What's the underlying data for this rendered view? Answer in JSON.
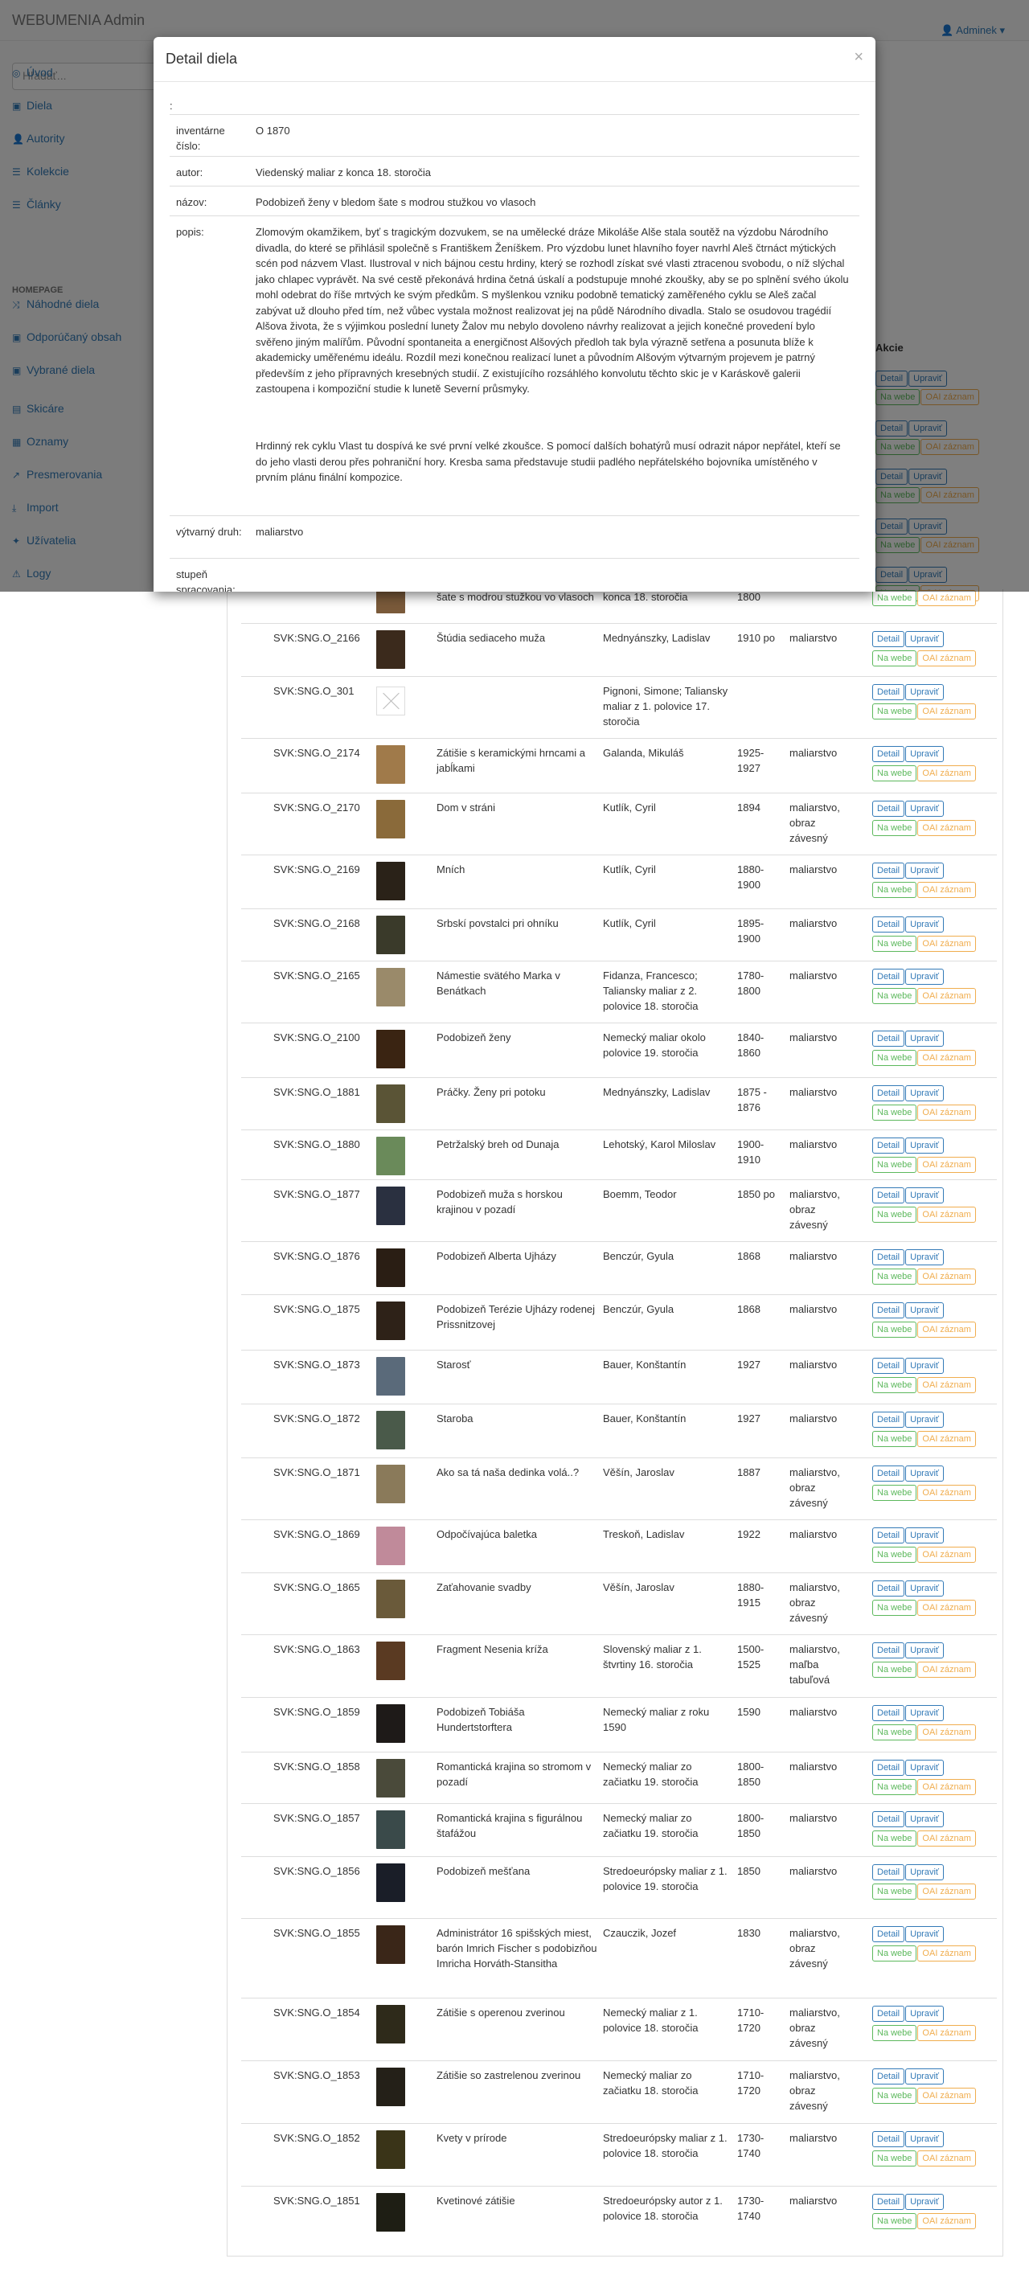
{
  "app": {
    "brand": "WEBUMENIA Admin",
    "user": "Adminek ▾"
  },
  "sidebar": {
    "search_placeholder": "Hľadať...",
    "items": [
      {
        "label": "Úvod",
        "icon": "dashboard-icon",
        "glyph": "◎"
      },
      {
        "label": "Diela",
        "icon": "image-icon",
        "glyph": "▣"
      },
      {
        "label": "Autority",
        "icon": "user-icon",
        "glyph": "👤"
      },
      {
        "label": "Kolekcie",
        "icon": "list-icon",
        "glyph": "☰"
      },
      {
        "label": "Články",
        "icon": "list-icon",
        "glyph": "☰"
      }
    ],
    "section": "HOMEPAGE",
    "items2": [
      {
        "label": "Náhodné diela",
        "icon": "random-icon",
        "glyph": "⤨"
      },
      {
        "label": "Odporúčaný obsah",
        "icon": "image-icon",
        "glyph": "▣"
      },
      {
        "label": "Vybrané diela",
        "icon": "image-icon",
        "glyph": "▣"
      }
    ],
    "items3": [
      {
        "label": "Skicáre",
        "icon": "book-icon",
        "glyph": "▤"
      },
      {
        "label": "Oznamy",
        "icon": "bullhorn-icon",
        "glyph": "▦"
      },
      {
        "label": "Presmerovania",
        "icon": "external-link-icon",
        "glyph": "↗"
      },
      {
        "label": "Import",
        "icon": "download-icon",
        "glyph": "⤓"
      },
      {
        "label": "Užívatelia",
        "icon": "male-icon",
        "glyph": "✦"
      },
      {
        "label": "Logy",
        "icon": "warning-icon",
        "glyph": "⚠"
      }
    ]
  },
  "modal": {
    "title": "Detail diela",
    "close": "×",
    "colon": ":",
    "rows": [
      {
        "label": "inventárne číslo:",
        "value": "O 1870"
      },
      {
        "label": "autor:",
        "value": "Viedenský maliar z konca 18. storočia"
      },
      {
        "label": "názov:",
        "value": "Podobizeň ženy v bledom šate s modrou stužkou vo vlasoch"
      },
      {
        "label": "popis:",
        "value": "Zlomovým okamžikem, byť s tragickým dozvukem, se na umělecké dráze Mikoláše Alše stala soutěž na výzdobu Národního divadla, do které se přihlásil společně s Františkem Ženíškem. Pro výzdobu lunet hlavního foyer navrhl Aleš čtrnáct mýtických scén pod názvem Vlast. Ilustroval v nich bájnou cestu hrdiny, který se rozhodl získat své vlasti ztracenou svobodu, o níž slýchal jako chlapec vyprávět. Na své cestě překonává hrdina četná úskalí a podstupuje mnohé zkoušky, aby se po splnění svého úkolu mohl odebrat do říše mrtvých ke svým předkům. S myšlenkou vzniku podobně tematický zaměřeného cyklu se Aleš začal zabývat už dlouho před tím, než vůbec vystala možnost realizovat jej na půdě Národního divadla. Stalo se osudovou tragédií Alšova života, že s výjimkou poslední lunety Žalov mu nebylo dovoleno návrhy realizovat a jejich konečné provedení bylo svěřeno jiným malířům. Původní spontaneita a energičnost Alšových předloh tak byla výrazně setřena a posunuta blíže k akademicky uměřenému ideálu. Rozdíl mezi konečnou realizací lunet a původním Alšovým výtvarným projevem je patrný především z jeho přípravných kresebných studií. Z existujícího rozsáhlého konvolutu těchto skic je v Karáskově galerii zastoupena i kompoziční studie k lunetě Severní průsmyky.",
        "value2": "Hrdinný rek cyklu Vlast tu dospívá ke své první velké zkoušce. S pomocí dalších bohatýrů musí odrazit nápor nepřátel, kteří se do jeho vlasti derou přes pohraniční hory. Kresba sama představuje studii padlého nepřátelského bojovníka umístěného v prvním plánu finální kompozice."
      },
      {
        "label": "výtvarný druh:",
        "value": "maliarstvo"
      },
      {
        "label": "stupeň spracovania:",
        "value": ""
      }
    ]
  },
  "behind": {
    "actions_header": "Akcie"
  },
  "buttons": {
    "detail": "Detail",
    "edit": "Upraviť",
    "web": "Na webe",
    "oai": "OAI záznam"
  },
  "first_row": {
    "name": "šate s modrou stužkou vo vlasoch",
    "author": "konca 18. storočia",
    "date": "1800",
    "type": "maliarstvo"
  },
  "rows": [
    {
      "id": "SVK:SNG.O_2166",
      "name": "Štúdia sediaceho muža",
      "author": "Mednyánszky, Ladislav",
      "date": "1910 po",
      "type": "maliarstvo",
      "color": "#3b2a1c"
    },
    {
      "id": "SVK:SNG.O_301",
      "name": "",
      "author": "Pignoni, Simone; Taliansky maliar z 1. polovice 17. storočia",
      "date": "",
      "type": "",
      "color": ""
    },
    {
      "id": "SVK:SNG.O_2174",
      "name": "Zátišie s keramickými hrncami a jabĺkami",
      "author": "Galanda, Mikuláš",
      "date": "1925-1927",
      "type": "maliarstvo",
      "color": "#a07a4a"
    },
    {
      "id": "SVK:SNG.O_2170",
      "name": "Dom v stráni",
      "author": "Kutlík, Cyril",
      "date": "1894",
      "type": "maliarstvo, obraz závesný",
      "color": "#8a6a3a"
    },
    {
      "id": "SVK:SNG.O_2169",
      "name": "Mních",
      "author": "Kutlík, Cyril",
      "date": "1880-1900",
      "type": "maliarstvo",
      "color": "#2a2218"
    },
    {
      "id": "SVK:SNG.O_2168",
      "name": "Srbskí povstalci pri ohníku",
      "author": "Kutlík, Cyril",
      "date": "1895-1900",
      "type": "maliarstvo",
      "color": "#3a3a2a"
    },
    {
      "id": "SVK:SNG.O_2165",
      "name": "Námestie svätého Marka v Benátkach",
      "author": "Fidanza, Francesco; Taliansky maliar z 2. polovice 18. storočia",
      "date": "1780-1800",
      "type": "maliarstvo",
      "color": "#9a8a6a"
    },
    {
      "id": "SVK:SNG.O_2100",
      "name": "Podobizeň ženy",
      "author": "Nemecký maliar okolo polovice 19. storočia",
      "date": "1840-1860",
      "type": "maliarstvo",
      "color": "#3a2412"
    },
    {
      "id": "SVK:SNG.O_1881",
      "name": "Práčky. Ženy pri potoku",
      "author": "Mednyánszky, Ladislav",
      "date": "1875 - 1876",
      "type": "maliarstvo",
      "color": "#5a5436"
    },
    {
      "id": "SVK:SNG.O_1880",
      "name": "Petržalský breh od Dunaja",
      "author": "Lehotský, Karol Miloslav",
      "date": "1900-1910",
      "type": "maliarstvo",
      "color": "#6a8a5a"
    },
    {
      "id": "SVK:SNG.O_1877",
      "name": "Podobizeň muža s horskou krajinou v pozadí",
      "author": "Boemm, Teodor",
      "date": "1850 po",
      "type": "maliarstvo, obraz závesný",
      "color": "#2a3040"
    },
    {
      "id": "SVK:SNG.O_1876",
      "name": "Podobizeň Alberta Ujházy",
      "author": "Benczúr, Gyula",
      "date": "1868",
      "type": "maliarstvo",
      "color": "#2a1e14"
    },
    {
      "id": "SVK:SNG.O_1875",
      "name": "Podobizeň Terézie Ujházy rodenej Prissnitzovej",
      "author": "Benczúr, Gyula",
      "date": "1868",
      "type": "maliarstvo",
      "color": "#2e2218"
    },
    {
      "id": "SVK:SNG.O_1873",
      "name": "Starosť",
      "author": "Bauer, Konštantín",
      "date": "1927",
      "type": "maliarstvo",
      "color": "#5a6a7a"
    },
    {
      "id": "SVK:SNG.O_1872",
      "name": "Staroba",
      "author": "Bauer, Konštantín",
      "date": "1927",
      "type": "maliarstvo",
      "color": "#4a5a4a"
    },
    {
      "id": "SVK:SNG.O_1871",
      "name": "Ako sa tá naša dedinka volá..?",
      "author": "Věšín, Jaroslav",
      "date": "1887",
      "type": "maliarstvo, obraz závesný",
      "color": "#8a7a5a"
    },
    {
      "id": "SVK:SNG.O_1869",
      "name": "Odpočívajúca baletka",
      "author": "Treskoň, Ladislav",
      "date": "1922",
      "type": "maliarstvo",
      "color": "#c08a9a"
    },
    {
      "id": "SVK:SNG.O_1865",
      "name": "Zaťahovanie svadby",
      "author": "Věšín, Jaroslav",
      "date": "1880-1915",
      "type": "maliarstvo, obraz závesný",
      "color": "#6a5a3a"
    },
    {
      "id": "SVK:SNG.O_1863",
      "name": "Fragment Nesenia kríža",
      "author": "Slovenský maliar z 1. štvrtiny 16. storočia",
      "date": "1500-1525",
      "type": "maliarstvo, maľba tabuľová",
      "color": "#5a3a22"
    },
    {
      "id": "SVK:SNG.O_1859",
      "name": "Podobizeň Tobiáša Hundertstorftera",
      "author": "Nemecký maliar z roku 1590",
      "date": "1590",
      "type": "maliarstvo",
      "color": "#1e1a18"
    },
    {
      "id": "SVK:SNG.O_1858",
      "name": "Romantická krajina so stromom v pozadí",
      "author": "Nemecký maliar zo začiatku 19. storočia",
      "date": "1800-1850",
      "type": "maliarstvo",
      "color": "#4a4a3a"
    },
    {
      "id": "SVK:SNG.O_1857",
      "name": "Romantická krajina s figurálnou štafážou",
      "author": "Nemecký maliar zo začiatku 19. storočia",
      "date": "1800-1850",
      "type": "maliarstvo",
      "color": "#3a4a4a"
    },
    {
      "id": "SVK:SNG.O_1856",
      "name": "Podobizeň mešťana",
      "author": "Stredoeurópsky maliar z 1. polovice 19. storočia",
      "date": "1850",
      "type": "maliarstvo",
      "color": "#1a1e28"
    },
    {
      "id": "SVK:SNG.O_1855",
      "name": "Administrátor 16 spišských miest, barón Imrich Fischer s podobizňou Imricha Horváth-Stansitha",
      "author": "Czauczik, Jozef",
      "date": "1830",
      "type": "maliarstvo, obraz závesný",
      "color": "#3a2618"
    },
    {
      "id": "SVK:SNG.O_1854",
      "name": "Zátišie s operenou zverinou",
      "author": "Nemecký maliar z 1. polovice 18. storočia",
      "date": "1710-1720",
      "type": "maliarstvo, obraz závesný",
      "color": "#2e2a1a"
    },
    {
      "id": "SVK:SNG.O_1853",
      "name": "Zátišie so zastrelenou zverinou",
      "author": "Nemecký maliar zo začiatku 18. storočia",
      "date": "1710-1720",
      "type": "maliarstvo, obraz závesný",
      "color": "#242018"
    },
    {
      "id": "SVK:SNG.O_1852",
      "name": "Kvety v prírode",
      "author": "Stredoeurópsky maliar z 1. polovice 18. storočia",
      "date": "1730-1740",
      "type": "maliarstvo",
      "color": "#3a3418"
    },
    {
      "id": "SVK:SNG.O_1851",
      "name": "Kvetinové zátišie",
      "author": "Stredoeurópsky autor z 1. polovice 18. storočia",
      "date": "1730-1740",
      "type": "maliarstvo",
      "color": "#1e1e14"
    }
  ]
}
